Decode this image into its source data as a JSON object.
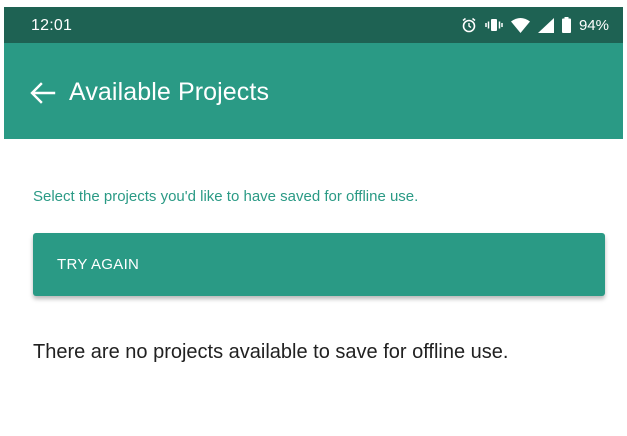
{
  "status_bar": {
    "time": "12:01",
    "icons": [
      "alarm-icon",
      "vibrate-icon",
      "wifi-icon",
      "signal-icon",
      "battery-icon"
    ],
    "battery": "94%"
  },
  "app_bar": {
    "title": "Available Projects",
    "back_icon": "back-arrow-icon",
    "color": "#2a9a85"
  },
  "main": {
    "hint": "Select the projects you'd like to have saved for offline use.",
    "try_again_label": "TRY AGAIN",
    "empty_message": "There are no projects available to save for offline use."
  },
  "colors": {
    "status_bar": "#1e6253",
    "accent": "#2a9a85"
  }
}
